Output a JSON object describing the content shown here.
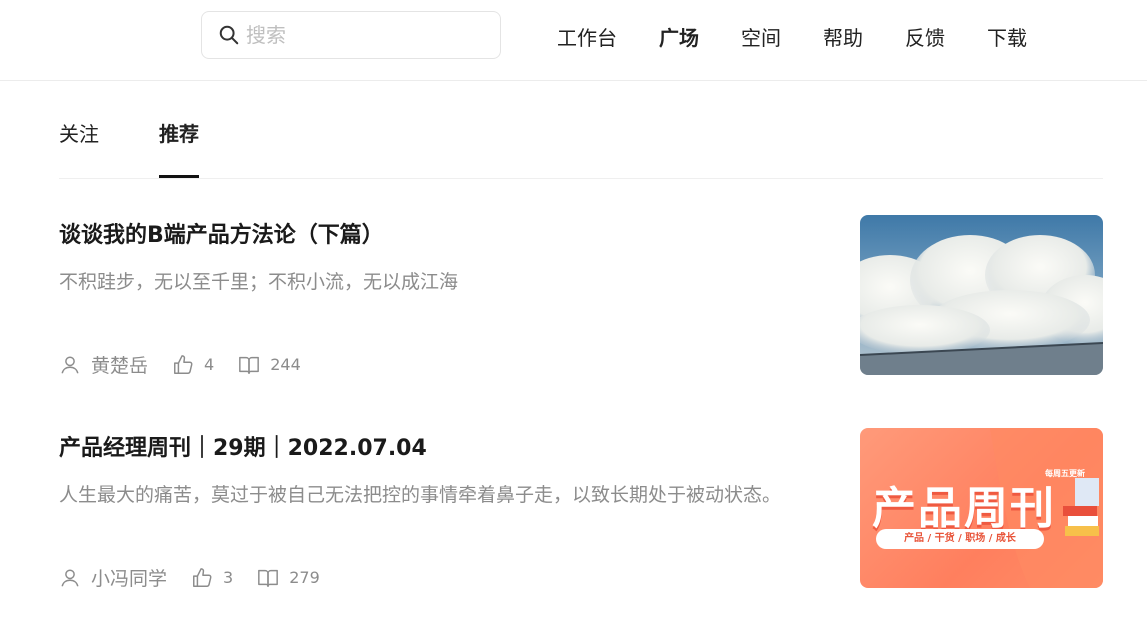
{
  "header": {
    "search_placeholder": "搜索",
    "nav": [
      {
        "label": "工作台",
        "active": false
      },
      {
        "label": "广场",
        "active": true
      },
      {
        "label": "空间",
        "active": false
      },
      {
        "label": "帮助",
        "active": false
      },
      {
        "label": "反馈",
        "active": false
      },
      {
        "label": "下载",
        "active": false
      }
    ]
  },
  "tabs": [
    {
      "label": "关注",
      "active": false
    },
    {
      "label": "推荐",
      "active": true
    }
  ],
  "articles": [
    {
      "title": "谈谈我的B端产品方法论（下篇）",
      "description": "不积跬步，无以至千里；不积小流，无以成江海",
      "author": "黄楚岳",
      "likes": "4",
      "reads": "244",
      "thumbnail": "sky-clouds-photo"
    },
    {
      "title": "产品经理周刊｜29期｜2022.07.04",
      "description": "人生最大的痛苦，莫过于被自己无法把控的事情牵着鼻子走，以致长期处于被动状态。",
      "author": "小冯同学",
      "likes": "3",
      "reads": "279",
      "thumbnail": {
        "headline": "产品周刊",
        "subline": "产品 / 干货 / 职场 / 成长",
        "tag": "每周五更新"
      }
    }
  ],
  "colors": {
    "text": "#1f1f1f",
    "muted": "#8c8c8c",
    "border": "#ececec",
    "cover_orange": "#ff7f5e"
  }
}
